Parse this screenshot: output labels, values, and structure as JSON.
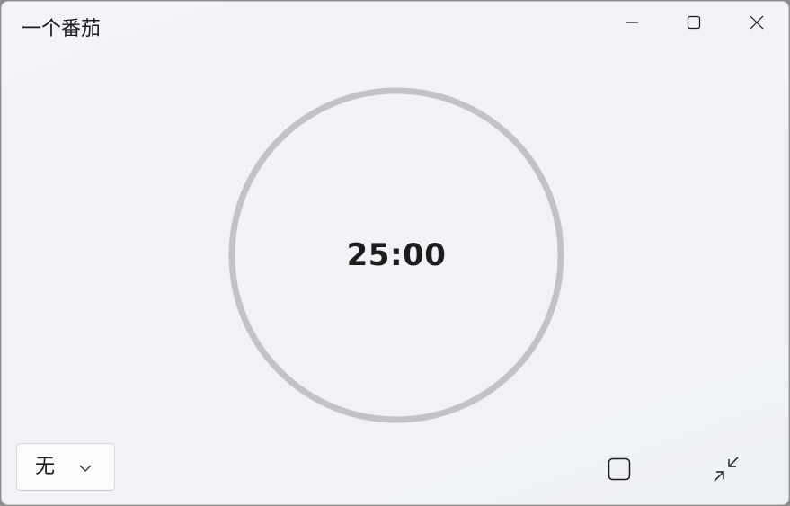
{
  "window": {
    "title": "一个番茄"
  },
  "caption_buttons": {
    "minimize": "minimize-icon",
    "maximize": "maximize-icon",
    "close": "close-icon"
  },
  "timer": {
    "display": "25:00",
    "progress_fraction": 0
  },
  "preset_select": {
    "selected": "无",
    "icon": "chevron-down-icon"
  },
  "toolbar": {
    "stop_icon": "square-stop-icon",
    "compact_icon": "collapse-arrows-icon"
  },
  "colors": {
    "ring": "#c2c3c6",
    "text": "#1c1c1c",
    "background": "#f2f3f8"
  }
}
